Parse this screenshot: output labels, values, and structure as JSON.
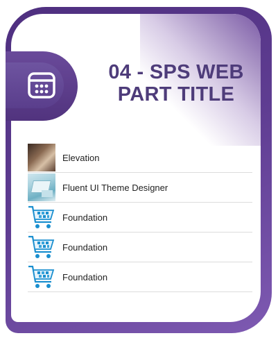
{
  "webpart": {
    "title": "04 - SPS WEB PART TITLE",
    "header_icon": "calendar-icon",
    "accent_color": "#5a3a8c",
    "title_color": "#4e3c7a"
  },
  "items": [
    {
      "label": "Elevation",
      "thumb": "photo"
    },
    {
      "label": "Fluent UI Theme Designer",
      "thumb": "photo"
    },
    {
      "label": "Foundation",
      "thumb": "shopping-cart-icon"
    },
    {
      "label": "Foundation",
      "thumb": "shopping-cart-icon"
    },
    {
      "label": "Foundation",
      "thumb": "shopping-cart-icon"
    }
  ]
}
